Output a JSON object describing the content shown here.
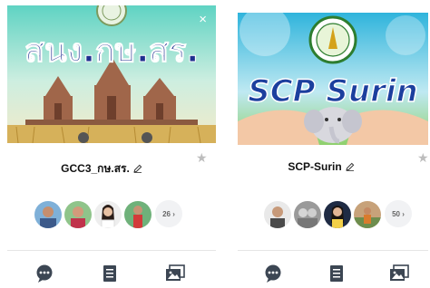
{
  "cards": [
    {
      "cover_text": "สนง.กษ.สร.",
      "close_glyph": "×",
      "name": "GCC3_กษ.สร.",
      "member_count": "26",
      "member_count_suffix": "›",
      "icons": [
        "chat-icon",
        "notes-icon",
        "album-icon"
      ]
    },
    {
      "cover_text": "SCP Surin",
      "name": "SCP-Surin",
      "member_count": "50",
      "member_count_suffix": "›",
      "icons": [
        "chat-icon",
        "notes-icon",
        "album-icon"
      ]
    }
  ],
  "colors": {
    "action_icon": "#3c4653",
    "star": "#bdbdbd",
    "cover1_text": "#1f2f8f",
    "cover2_text": "#1c3f9e"
  }
}
